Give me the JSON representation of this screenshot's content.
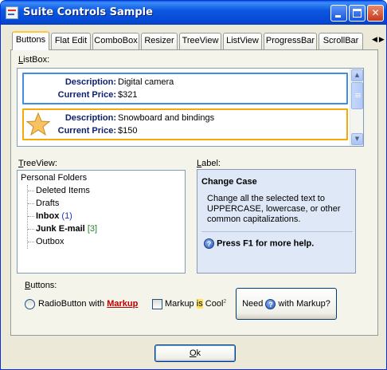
{
  "window": {
    "title": "Suite Controls Sample"
  },
  "caption_buttons": {
    "minimize": "_",
    "maximize": "□",
    "close": "✕"
  },
  "tabs": [
    {
      "label": "Buttons",
      "active": true
    },
    {
      "label": "Flat Edit"
    },
    {
      "label": "ComboBox"
    },
    {
      "label": "Resizer"
    },
    {
      "label": "TreeView"
    },
    {
      "label": "ListView"
    },
    {
      "label": "ProgressBar"
    },
    {
      "label": "ScrollBar"
    }
  ],
  "tab_scroll": {
    "left": "◀",
    "right": "▶"
  },
  "listbox": {
    "label_first": "L",
    "label_rest": "istBox:",
    "items": [
      {
        "description_label": "Description:",
        "description": "Digital camera",
        "price_label": "Current Price:",
        "price": "$321"
      },
      {
        "description_label": "Description:",
        "description": "Snowboard and bindings",
        "price_label": "Current Price:",
        "price": "$150",
        "icon": "star-icon"
      }
    ],
    "scroll_up": "▲",
    "scroll_down": "▼"
  },
  "treeview": {
    "label_first": "T",
    "label_rest": "reeView:",
    "root": "Personal Folders",
    "items": [
      {
        "label": "Deleted Items"
      },
      {
        "label": "Drafts"
      },
      {
        "label": "Inbox",
        "count": "(1)"
      },
      {
        "label": "Junk E-mail",
        "count": "[3]"
      },
      {
        "label": "Outbox"
      }
    ]
  },
  "label_panel": {
    "label_first": "L",
    "label_rest": "abel:",
    "title": "Change Case",
    "body": "Change all the selected text to UPPERCASE, lowercase, or other common capitalizations.",
    "help": "Press F1 for more help.",
    "help_icon_glyph": "?"
  },
  "buttons_section": {
    "label_first": "B",
    "label_rest": "uttons:",
    "radio": {
      "prefix": "RadioButton with ",
      "markup": "Markup"
    },
    "checkbox": {
      "prefix": "Markup ",
      "highlight": "is",
      "suffix": " Cool",
      "sup": "2"
    },
    "need_button": {
      "prefix": "Need ",
      "suffix": " with Markup?"
    }
  },
  "ok_button": {
    "label_first": "O",
    "label_rest": "k"
  }
}
